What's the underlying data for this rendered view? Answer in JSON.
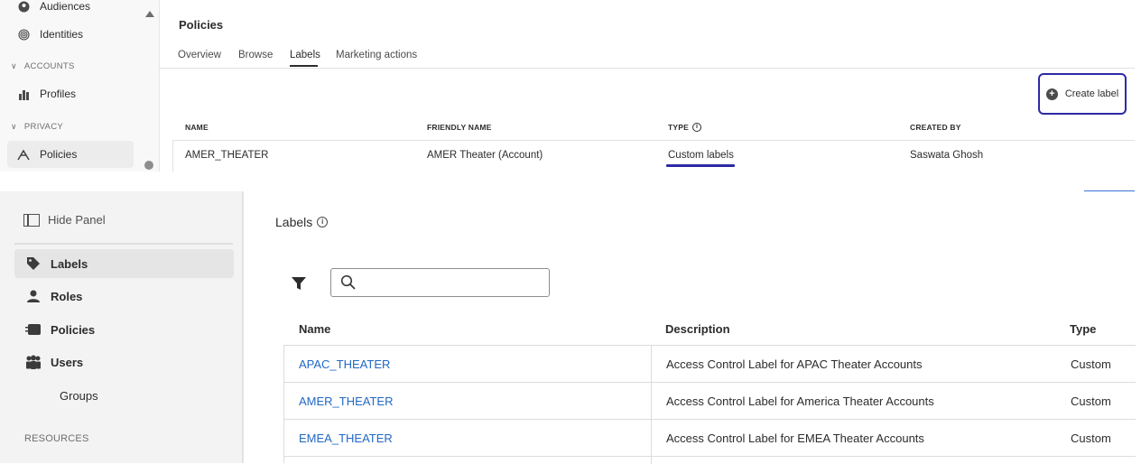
{
  "top": {
    "sidebar": {
      "items": [
        {
          "label": "Audiences",
          "icon": "audiences-icon"
        },
        {
          "label": "Identities",
          "icon": "fingerprint-icon"
        },
        {
          "label": "Profiles",
          "icon": "profiles-icon"
        },
        {
          "label": "Policies",
          "icon": "policies-icon",
          "active": true
        }
      ],
      "sections": [
        "ACCOUNTS",
        "PRIVACY"
      ]
    },
    "page_title": "Policies",
    "tabs": [
      "Overview",
      "Browse",
      "Labels",
      "Marketing actions"
    ],
    "active_tab": "Labels",
    "create_label": "Create label",
    "table": {
      "headers": [
        "NAME",
        "FRIENDLY NAME",
        "TYPE",
        "CREATED BY"
      ],
      "row": {
        "name": "AMER_THEATER",
        "friendly_name": "AMER Theater (Account)",
        "type": "Custom labels",
        "created_by": "Saswata Ghosh"
      }
    },
    "highlight_color": "#2d2aa5"
  },
  "bottom": {
    "hide_panel": "Hide Panel",
    "nav": [
      {
        "label": "Labels",
        "icon": "tag-icon",
        "active": true
      },
      {
        "label": "Roles",
        "icon": "user-icon"
      },
      {
        "label": "Policies",
        "icon": "policies-icon"
      },
      {
        "label": "Users",
        "icon": "users-icon"
      }
    ],
    "groups": "Groups",
    "resources": "RESOURCES",
    "heading": "Labels",
    "search": {
      "value": "",
      "placeholder": ""
    },
    "table": {
      "headers": [
        "Name",
        "Description",
        "Type"
      ],
      "rows": [
        {
          "name": "APAC_THEATER",
          "description": "Access Control Label for APAC Theater Accounts",
          "type": "Custom"
        },
        {
          "name": "AMER_THEATER",
          "description": "Access Control Label for America Theater Accounts",
          "type": "Custom"
        },
        {
          "name": "EMEA_THEATER",
          "description": "Access Control Label for EMEA Theater Accounts",
          "type": "Custom"
        }
      ]
    },
    "link_color": "#2268c5"
  }
}
